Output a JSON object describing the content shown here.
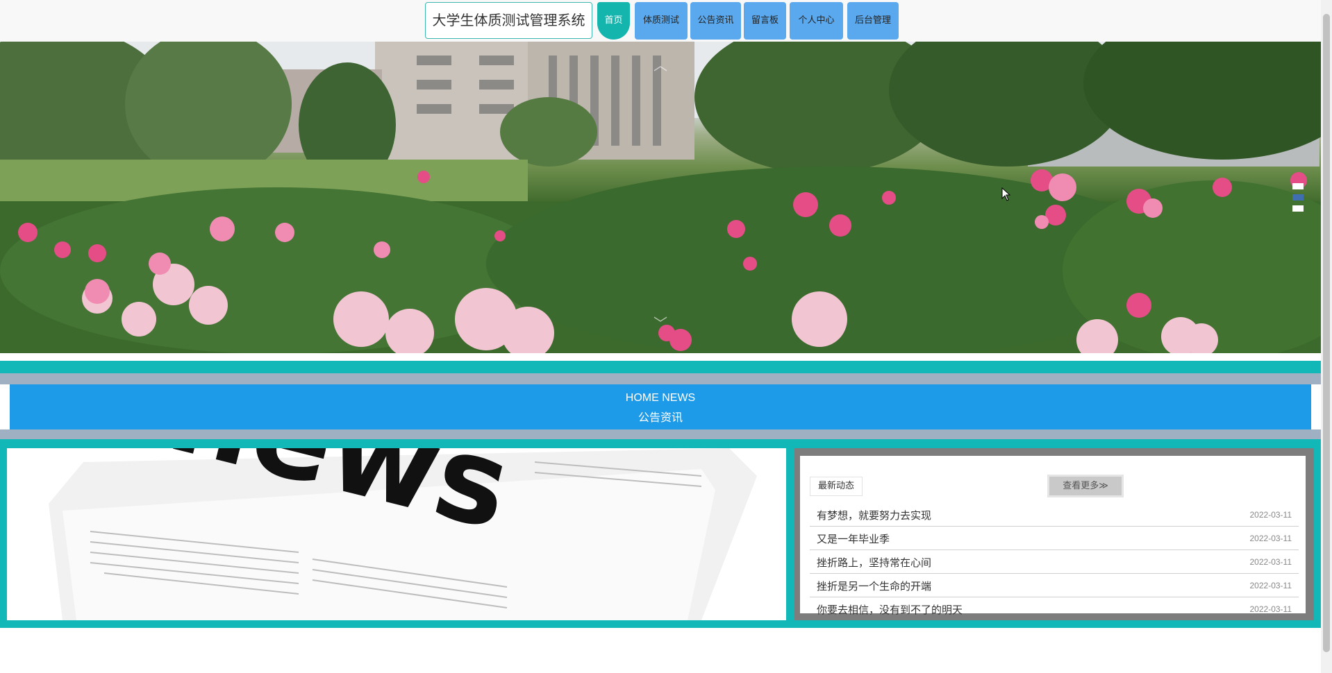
{
  "header": {
    "brand": "大学生体质测试管理系统",
    "nav": [
      {
        "label": "首页",
        "active": true
      },
      {
        "label": "体质测试",
        "active": false
      },
      {
        "label": "公告资讯",
        "active": false
      },
      {
        "label": "留言板",
        "active": false
      },
      {
        "label": "个人中心",
        "active": false
      },
      {
        "label": "后台管理",
        "active": false
      }
    ]
  },
  "carousel": {
    "slide_count": 3,
    "active_index": 1,
    "icons": {
      "prev": "chevron-up-icon",
      "next": "chevron-down-icon"
    }
  },
  "news_section": {
    "title_en": "HOME NEWS",
    "title_zh": "公告资讯",
    "image_text": "news",
    "latest_label": "最新动态",
    "more_label": "查看更多",
    "items": [
      {
        "title": "有梦想，就要努力去实现",
        "date": "2022-03-11"
      },
      {
        "title": "又是一年毕业季",
        "date": "2022-03-11"
      },
      {
        "title": "挫折路上，坚持常在心间",
        "date": "2022-03-11"
      },
      {
        "title": "挫折是另一个生命的开端",
        "date": "2022-03-11"
      },
      {
        "title": "你要去相信，没有到不了的明天",
        "date": "2022-03-11"
      }
    ]
  },
  "colors": {
    "accent": "#13b5ad",
    "nav_button": "#5aa9ee",
    "news_header": "#1e9be8",
    "band": "#12b8b8"
  }
}
